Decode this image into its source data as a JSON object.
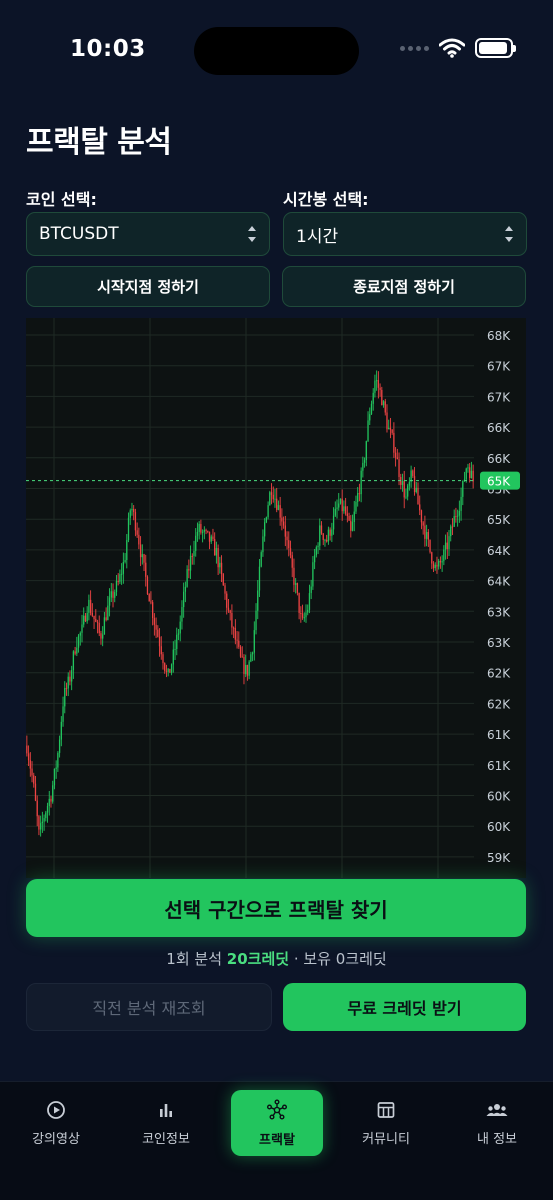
{
  "status_bar": {
    "time": "10:03"
  },
  "page_title": "프랙탈 분석",
  "coin_select": {
    "label": "코인 선택:",
    "value": "BTCUSDT"
  },
  "timeframe_select": {
    "label": "시간봉 선택:",
    "value": "1시간"
  },
  "point_buttons": {
    "start": "시작지점 정하기",
    "end": "종료지점 정하기"
  },
  "chart": {
    "y_tick_labels": [
      "68K",
      "67K",
      "67K",
      "66K",
      "66K",
      "65K",
      "65K",
      "64K",
      "64K",
      "63K",
      "63K",
      "62K",
      "62K",
      "61K",
      "61K",
      "60K",
      "60K",
      "59K"
    ],
    "current_price_label": "65K",
    "up_color": "#22c55e",
    "down_color": "#ef4444"
  },
  "chart_data": {
    "type": "candlestick",
    "y_unit": "USDT",
    "ylim": [
      59000,
      68300
    ],
    "current_price": 65600,
    "grid": true,
    "price_line": "dashed",
    "approx_path": [
      [
        0,
        61200
      ],
      [
        4,
        60600
      ],
      [
        8,
        59700
      ],
      [
        12,
        60100
      ],
      [
        16,
        60400
      ],
      [
        20,
        61000
      ],
      [
        24,
        62000
      ],
      [
        28,
        62300
      ],
      [
        32,
        62900
      ],
      [
        36,
        63100
      ],
      [
        40,
        63600
      ],
      [
        44,
        63300
      ],
      [
        48,
        63000
      ],
      [
        52,
        63400
      ],
      [
        56,
        63700
      ],
      [
        60,
        63900
      ],
      [
        64,
        64300
      ],
      [
        68,
        65200
      ],
      [
        72,
        64800
      ],
      [
        76,
        64200
      ],
      [
        80,
        63700
      ],
      [
        84,
        63200
      ],
      [
        88,
        62800
      ],
      [
        92,
        62300
      ],
      [
        96,
        62700
      ],
      [
        100,
        63200
      ],
      [
        104,
        63900
      ],
      [
        108,
        64400
      ],
      [
        112,
        64800
      ],
      [
        116,
        64700
      ],
      [
        120,
        64600
      ],
      [
        124,
        64400
      ],
      [
        128,
        63900
      ],
      [
        132,
        63400
      ],
      [
        136,
        63000
      ],
      [
        140,
        62600
      ],
      [
        144,
        62400
      ],
      [
        148,
        62900
      ],
      [
        152,
        64000
      ],
      [
        156,
        65000
      ],
      [
        160,
        65500
      ],
      [
        164,
        65200
      ],
      [
        168,
        64900
      ],
      [
        172,
        64300
      ],
      [
        176,
        63800
      ],
      [
        180,
        63200
      ],
      [
        184,
        63500
      ],
      [
        188,
        64300
      ],
      [
        192,
        64800
      ],
      [
        196,
        64600
      ],
      [
        200,
        64900
      ],
      [
        204,
        65200
      ],
      [
        208,
        65100
      ],
      [
        212,
        64700
      ],
      [
        216,
        65300
      ],
      [
        220,
        65800
      ],
      [
        224,
        66700
      ],
      [
        228,
        67300
      ],
      [
        232,
        67000
      ],
      [
        236,
        66500
      ],
      [
        240,
        66200
      ],
      [
        244,
        65700
      ],
      [
        248,
        65300
      ],
      [
        252,
        65700
      ],
      [
        256,
        65200
      ],
      [
        260,
        64800
      ],
      [
        264,
        64400
      ],
      [
        268,
        64100
      ],
      [
        272,
        64300
      ],
      [
        276,
        64600
      ],
      [
        280,
        65000
      ],
      [
        284,
        65300
      ],
      [
        288,
        65900
      ],
      [
        292,
        65600
      ]
    ]
  },
  "primary_button": "선택 구간으로 프랙탈 찾기",
  "credit_info": {
    "prefix": "1회 분석 ",
    "cost": "20크레딧",
    "suffix": " · 보유 0크레딧"
  },
  "secondary_buttons": {
    "reload": "직전 분석 재조회",
    "free_credit": "무료 크레딧 받기"
  },
  "tabbar": [
    {
      "label": "강의영상",
      "icon": "play-circle-icon"
    },
    {
      "label": "코인정보",
      "icon": "bar-chart-icon"
    },
    {
      "label": "프랙탈",
      "icon": "network-icon",
      "active": true
    },
    {
      "label": "커뮤니티",
      "icon": "board-icon"
    },
    {
      "label": "내 정보",
      "icon": "users-icon"
    }
  ]
}
